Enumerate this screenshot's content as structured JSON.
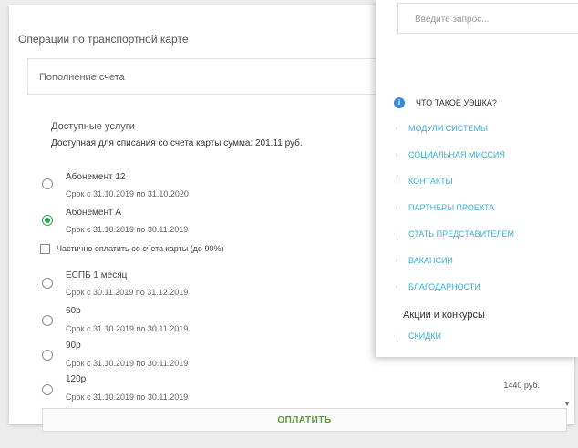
{
  "card": {
    "title": "Операции по транспортной карте",
    "operation_select": "Пополнение счета",
    "services_heading": "Доступные услуги",
    "services_subheading": "Доступная для списания со счета карты сумма: 201.11 руб."
  },
  "options": [
    {
      "name": "Абонемент 12",
      "date": "Срок с 31.10.2019 по 31.10.2020",
      "selected": false
    },
    {
      "name": "Абонемент А",
      "date": "Срок с 31.10.2019 по 30.11.2019",
      "selected": true
    },
    {
      "name": "ЕСПБ 1 месяц",
      "date": "Срок с 30.11.2019 по 31.12.2019",
      "selected": false
    },
    {
      "name": "60р",
      "date": "Срок с 31.10.2019 по 30.11.2019",
      "selected": false
    },
    {
      "name": "90р",
      "date": "Срок с 31.10.2019 по 30.11.2019",
      "selected": false
    },
    {
      "name": "120р",
      "date": "Срок с 31.10.2019 по 30.11.2019",
      "selected": false,
      "price": "1440 руб."
    }
  ],
  "partial_pay": {
    "label": "Частично оплатить со счета карты (до 90%)",
    "checked": false
  },
  "pay_button": "ОПЛАТИТЬ",
  "panel": {
    "search_placeholder": "Введите запрос...",
    "menu_title": "ЧТО ТАКОЕ УЭШКА?",
    "menu_items": [
      "МОДУЛИ СИСТЕМЫ",
      "СОЦИАЛЬНАЯ МИССИЯ",
      "КОНТАКТЫ",
      "ПАРТНЕРЫ ПРОЕКТА",
      "СТАТЬ ПРЕДСТАВИТЕЛЕМ",
      "ВАКАНСИИ",
      "БЛАГОДАРНОСТИ"
    ],
    "promo_heading": "Акции и конкурсы",
    "promo_items": [
      "СКИДКИ"
    ]
  },
  "colors": {
    "accent_green": "#2ea44f",
    "link_blue": "#3bb0d8",
    "info_blue": "#3b8ad6"
  },
  "icons": {
    "bullet": "chevron-right-icon",
    "info": "info-icon",
    "scroll": "scroll-down-arrow-icon"
  }
}
